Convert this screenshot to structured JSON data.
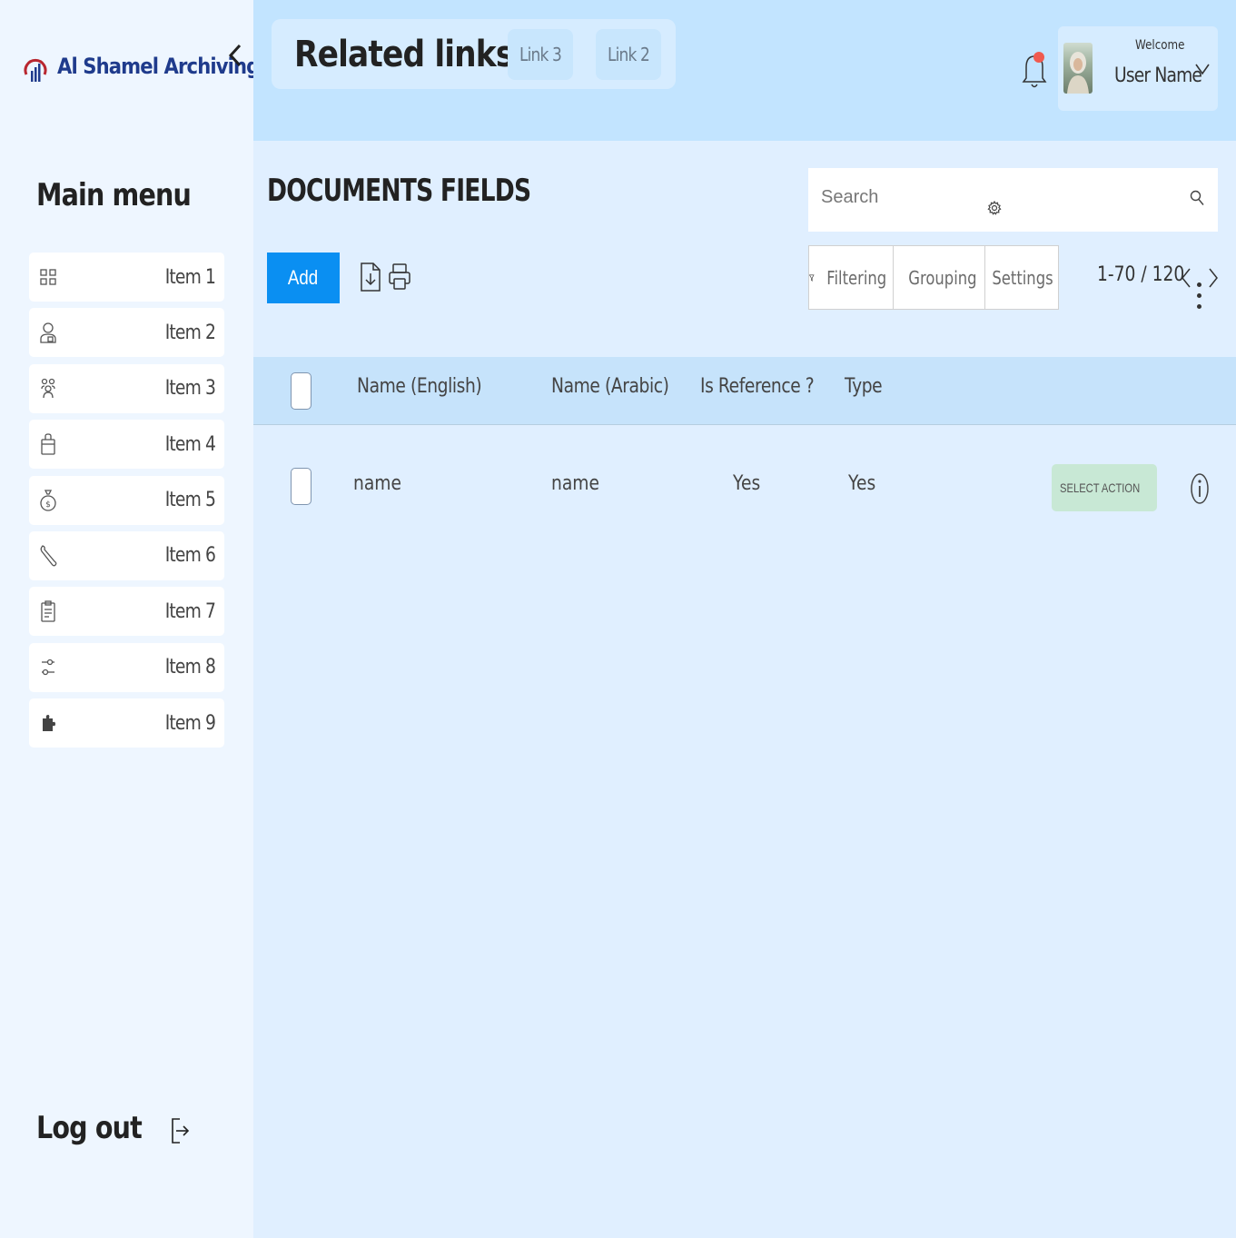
{
  "brand": {
    "name": "Al Shamel Archiving"
  },
  "sidebar": {
    "title": "Main menu",
    "items": [
      {
        "label": "Item 1",
        "icon": "grid-icon"
      },
      {
        "label": "Item 2",
        "icon": "user-icon"
      },
      {
        "label": "Item 3",
        "icon": "group-icon"
      },
      {
        "label": "Item 4",
        "icon": "bag-icon"
      },
      {
        "label": "Item 5",
        "icon": "money-bag-icon"
      },
      {
        "label": "Item 6",
        "icon": "wrench-icon"
      },
      {
        "label": "Item 7",
        "icon": "clipboard-icon"
      },
      {
        "label": "Item 8",
        "icon": "sliders-icon"
      },
      {
        "label": "Item 9",
        "icon": "puzzle-icon"
      }
    ],
    "logout_label": "Log out"
  },
  "header": {
    "links_title": "Related links",
    "links": [
      {
        "label": "Link 3"
      },
      {
        "label": "Link 2"
      }
    ],
    "notification_dot_color": "#f05a4f",
    "user": {
      "welcome": "Welcome",
      "name": "User Name"
    }
  },
  "main": {
    "title": "DOCUMENTS FIELDS",
    "search": {
      "placeholder": "Search"
    },
    "toolbar": {
      "add_label": "Add",
      "filtering_label": "Filtering",
      "grouping_label": "Grouping",
      "settings_label": "Settings",
      "pager": "1-70  /  120"
    },
    "table": {
      "columns": [
        "Name  (English)",
        "Name  (Arabic)",
        "Is Reference ?",
        "Type"
      ],
      "rows": [
        {
          "name_en": "name",
          "name_ar": "name",
          "is_reference": "Yes",
          "type": "Yes",
          "action_label": "SELECT ACTION"
        }
      ]
    }
  },
  "colors": {
    "accent": "#0a8ff2",
    "topbar": "#c2e4ff",
    "sidebar": "#eef6ff",
    "content": "#e0efff",
    "action_button": "#c8e8d5"
  }
}
